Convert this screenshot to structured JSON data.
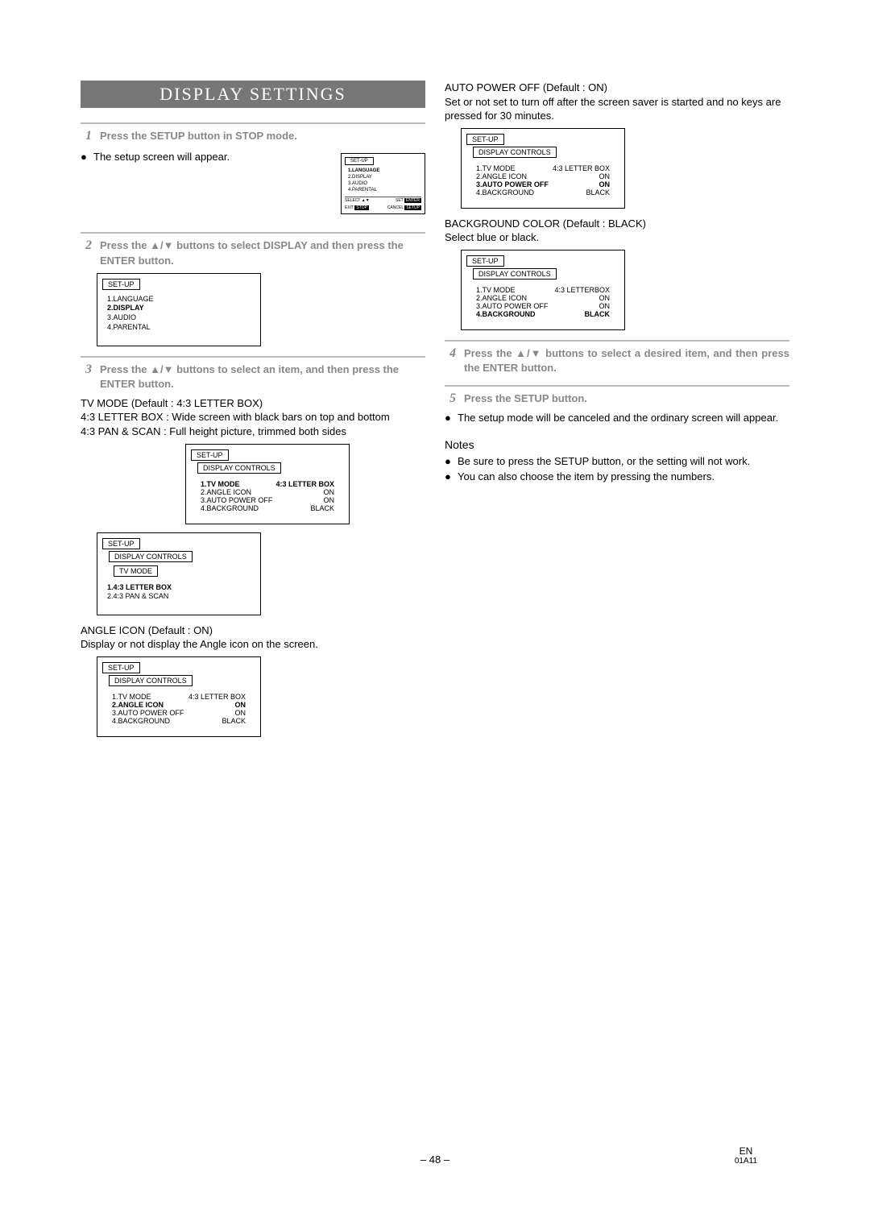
{
  "title": "DISPLAY SETTINGS",
  "steps": {
    "s1": {
      "num": "1",
      "text": "Press the SETUP button in STOP mode."
    },
    "s2": {
      "num": "2",
      "text": "Press the ▲/▼ buttons to select DISPLAY and then press the ENTER button."
    },
    "s3": {
      "num": "3",
      "text": "Press the ▲/▼ buttons to select an item, and then press the ENTER button."
    },
    "s4": {
      "num": "4",
      "text": "Press the ▲/▼ buttons to select a desired item, and then press the ENTER button."
    },
    "s5": {
      "num": "5",
      "text": "Press the SETUP button."
    }
  },
  "body": {
    "setup_appear": "The setup screen will appear.",
    "tvmode_title": "TV MODE (Default : 4:3 LETTER BOX)",
    "tvmode_l1": "4:3 LETTER BOX : Wide screen with black bars on top and bottom",
    "tvmode_l2": "4:3 PAN & SCAN : Full height picture, trimmed both sides",
    "angle_title": "ANGLE ICON (Default : ON)",
    "angle_desc": "Display or not display the Angle icon on the screen.",
    "autoff_title": "AUTO POWER OFF (Default : ON)",
    "autoff_desc": "Set or not set to turn off after the screen saver is started and no keys are pressed for 30 minutes.",
    "bg_title": "BACKGROUND COLOR (Default : BLACK)",
    "bg_desc": "Select blue or black.",
    "cancel_text": "The setup mode will be canceled and the ordinary screen will appear.",
    "notes_head": "Notes",
    "note1": "Be sure to press the SETUP button, or the setting will not work.",
    "note2": "You can also choose the item by pressing the numbers."
  },
  "osd": {
    "setup": "SET-UP",
    "display_controls": "DISPLAY CONTROLS",
    "tv_mode": "TV MODE",
    "menu1": {
      "i1": "1.LANGUAGE",
      "i2": "2.DISPLAY",
      "i3": "3.AUDIO",
      "i4": "4.PARENTAL"
    },
    "menu2_hl": "2.DISPLAY",
    "dcrows": {
      "r1l": "1.TV MODE",
      "r1r": "4:3 LETTER BOX",
      "r2l": "2.ANGLE ICON",
      "r2r": "ON",
      "r3l": "3.AUTO POWER OFF",
      "r3r": "ON",
      "r4l": "4.BACKGROUND",
      "r4r": "BLACK",
      "r1r_alt": "4:3 LETTERBOX"
    },
    "tvmode_opts": {
      "o1": "1.4:3 LETTER BOX",
      "o2": "2.4:3 PAN & SCAN"
    },
    "footer": {
      "select": "SELECT",
      "exit": "EXIT",
      "set": "SET",
      "cancel": "CANCEL",
      "enter": "ENTER",
      "stop": "STOP",
      "setup_btn": "SETUP"
    }
  },
  "footer": {
    "page": "– 48 –",
    "lang": "EN",
    "code": "01A11"
  }
}
